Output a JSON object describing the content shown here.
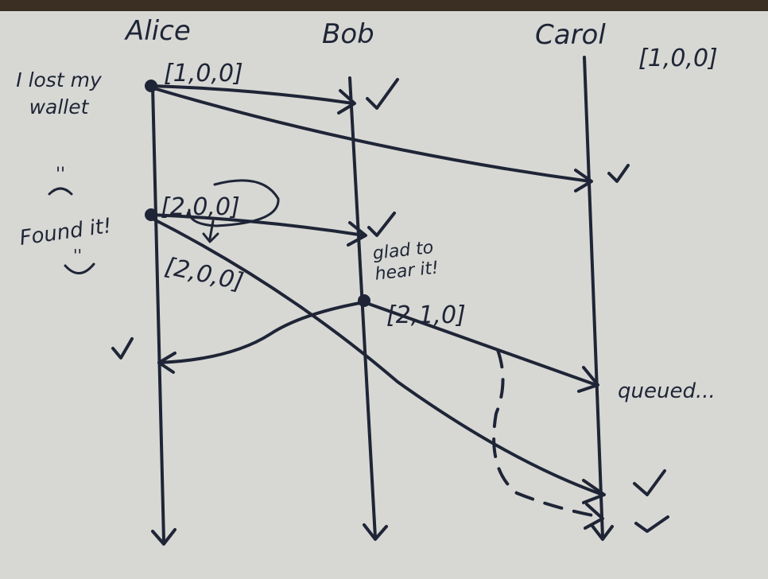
{
  "colors": {
    "paper": "#d7d8d4",
    "ink": "#1f2536",
    "frame": "#3a2f22"
  },
  "participants": [
    {
      "id": "alice",
      "name": "Alice"
    },
    {
      "id": "bob",
      "name": "Bob"
    },
    {
      "id": "carol",
      "name": "Carol"
    }
  ],
  "notes": {
    "alice_1": "I lost my wallet",
    "alice_2": "Found it!",
    "bob_1": "glad to hear it!",
    "carol_1": "queued..."
  },
  "clocks": {
    "alice_first": "[1,0,0]",
    "carol_initial": "[1,0,0]",
    "alice_second": "[2,0,0]",
    "alice_second_label": "[2,0,0]",
    "bob_reply": "[2,1,0]"
  },
  "messages": [
    {
      "from": "alice",
      "to": "bob",
      "clock": "[1,0,0]",
      "status": "delivered"
    },
    {
      "from": "alice",
      "to": "carol",
      "clock": "[1,0,0]",
      "status": "delivered"
    },
    {
      "from": "alice",
      "to": "bob",
      "clock": "[2,0,0]",
      "status": "delivered"
    },
    {
      "from": "alice",
      "to": "carol",
      "clock": "[2,0,0]",
      "status": "delivered"
    },
    {
      "from": "bob",
      "to": "alice",
      "clock": "[2,1,0]",
      "status": "delivered"
    },
    {
      "from": "bob",
      "to": "carol",
      "clock": "[2,1,0]",
      "status": "queued, then delivered"
    }
  ],
  "icons": {
    "delivered": "checkmark-icon",
    "event": "dot-icon"
  }
}
